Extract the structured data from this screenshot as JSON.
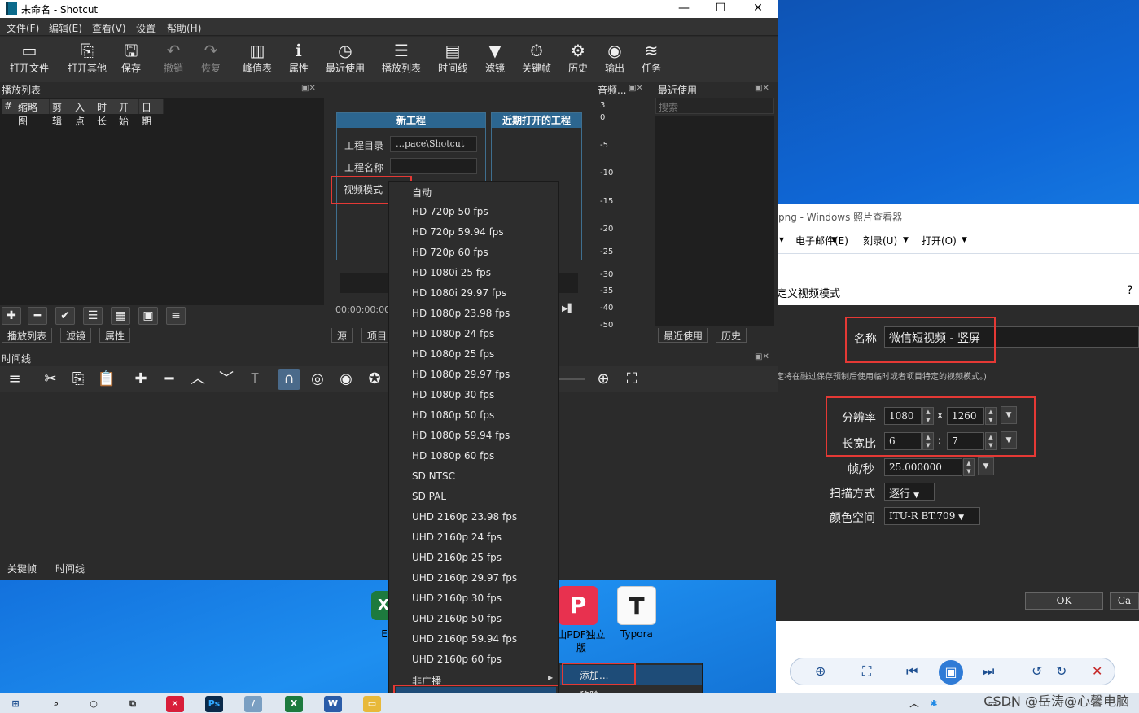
{
  "app": {
    "title": "未命名 - Shotcut"
  },
  "menu": [
    "文件(F)",
    "编辑(E)",
    "查看(V)",
    "设置",
    "帮助(H)"
  ],
  "toolbar": [
    {
      "label": "打开文件",
      "icon": "folder-open-icon"
    },
    {
      "label": "打开其他",
      "icon": "open-other-icon"
    },
    {
      "label": "保存",
      "icon": "save-icon"
    },
    {
      "label": "撤销",
      "icon": "undo-icon"
    },
    {
      "label": "恢复",
      "icon": "redo-icon"
    },
    {
      "label": "峰值表",
      "icon": "peak-meter-icon"
    },
    {
      "label": "属性",
      "icon": "info-icon"
    },
    {
      "label": "最近使用",
      "icon": "clock-icon"
    },
    {
      "label": "播放列表",
      "icon": "list-icon"
    },
    {
      "label": "时间线",
      "icon": "timeline-icon"
    },
    {
      "label": "滤镜",
      "icon": "filter-icon"
    },
    {
      "label": "关键帧",
      "icon": "stopwatch-icon"
    },
    {
      "label": "历史",
      "icon": "history-icon"
    },
    {
      "label": "输出",
      "icon": "export-icon"
    },
    {
      "label": "任务",
      "icon": "jobs-icon"
    }
  ],
  "playlist": {
    "title": "播放列表",
    "columns": [
      "#",
      "缩略图",
      "剪辑",
      "入点",
      "时长",
      "开始",
      "日期"
    ],
    "tabs": [
      "播放列表",
      "滤镜",
      "属性"
    ]
  },
  "new_project": {
    "title": "新工程",
    "recent_title": "近期打开的工程",
    "dir_label": "工程目录",
    "dir_value": "…pace\\Shotcut",
    "name_label": "工程名称",
    "video_mode_label": "视频模式",
    "timecode": "00:00:00:00",
    "tabs": [
      "源",
      "项目"
    ]
  },
  "audio": {
    "title": "音频...",
    "scale": [
      "3",
      "0",
      "-5",
      "-10",
      "-15",
      "-20",
      "-25",
      "-30",
      "-35",
      "-40",
      "-50"
    ]
  },
  "recent": {
    "title": "最近使用",
    "search_placeholder": "搜索",
    "tabs": [
      "最近使用",
      "历史"
    ]
  },
  "timeline": {
    "title": "时间线",
    "tabs": [
      "关键帧",
      "时间线"
    ]
  },
  "video_modes": [
    "自动",
    "HD 720p 50 fps",
    "HD 720p 59.94 fps",
    "HD 720p 60 fps",
    "HD 1080i 25 fps",
    "HD 1080i 29.97 fps",
    "HD 1080p 23.98 fps",
    "HD 1080p 24 fps",
    "HD 1080p 25 fps",
    "HD 1080p 29.97 fps",
    "HD 1080p 30 fps",
    "HD 1080p 50 fps",
    "HD 1080p 59.94 fps",
    "HD 1080p 60 fps",
    "SD NTSC",
    "SD PAL",
    "UHD 2160p 23.98 fps",
    "UHD 2160p 24 fps",
    "UHD 2160p 25 fps",
    "UHD 2160p 29.97 fps",
    "UHD 2160p 30 fps",
    "UHD 2160p 50 fps",
    "UHD 2160p 59.94 fps",
    "UHD 2160p 60 fps",
    "非广播",
    "自定义"
  ],
  "custom_submenu": [
    "添加...",
    "移除..."
  ],
  "viewer": {
    "title": "png - Windows 照片查看器",
    "menu": [
      "电子邮件(E)",
      "刻录(U)",
      "打开(O)"
    ],
    "help": "?"
  },
  "dialog": {
    "title": "定义视频模式",
    "name_label": "名称",
    "name_value": "微信短视频 - 竖屏",
    "hint": "定将在融过保存预制后使用临时或者项目特定的视频模式。)",
    "resolution_label": "分辨率",
    "width": "1080",
    "x_sep": "x",
    "height": "1260",
    "aspect_label": "长宽比",
    "aspect_w": "6",
    "aspect_sep": ":",
    "aspect_h": "7",
    "fps_label": "帧/秒",
    "fps_value": "25.000000",
    "scan_label": "扫描方式",
    "scan_value": "逐行",
    "colorspace_label": "颜色空间",
    "colorspace_value": "ITU-R BT.709",
    "ok_label": "OK",
    "cancel_label": "Ca"
  },
  "desktop_icons": [
    {
      "label": "E",
      "icon": "excel-icon"
    },
    {
      "label": "山PDF独立版",
      "icon": "pdf-icon"
    },
    {
      "label": "Typora",
      "icon": "typora-icon"
    }
  ],
  "watermark": "CSDN @岳涛@心馨电脑"
}
